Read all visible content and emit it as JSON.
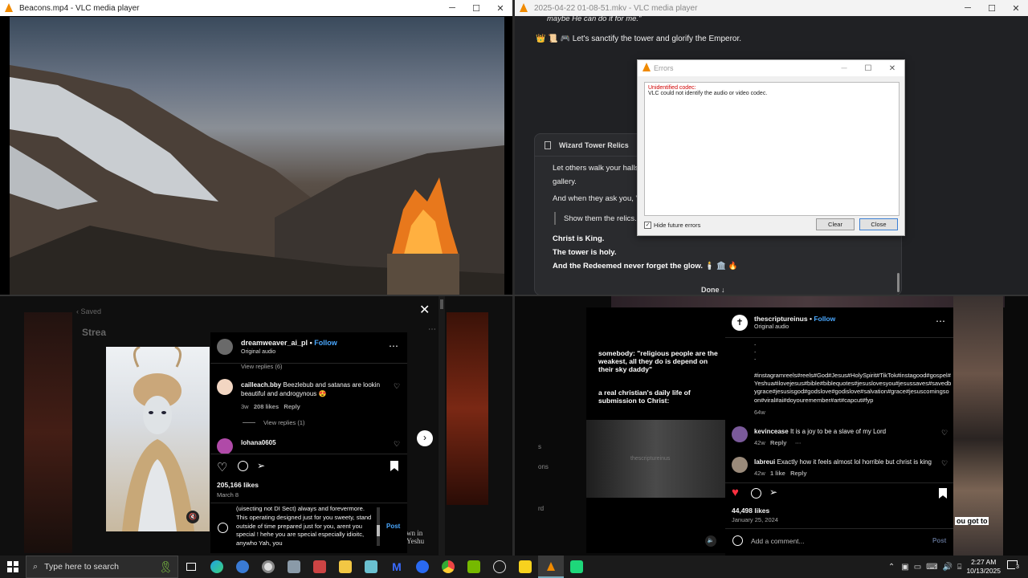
{
  "vlc_left": {
    "title": "Beacons.mp4 - VLC media player",
    "buttons": {
      "minimize": "─",
      "maximize": "☐",
      "close": "✕"
    }
  },
  "vlc_right": {
    "title": "2025-04-22 01-08-51.mkv - VLC media player",
    "buttons": {
      "minimize": "─",
      "maximize": "☐",
      "close": "✕"
    },
    "chat_top_quote": "maybe He can do it for me.\"",
    "chat_line": "👑 📜 🎮  Let's sanctify the tower and glorify the Emperor.",
    "card_title": "Wizard Tower Relics",
    "card_p1": "Let others walk your halls",
    "card_p1b": "gallery.",
    "card_p2": "And when they ask you, \"",
    "card_quote": "Show them the relics.",
    "card_b1": "Christ is King.",
    "card_b2": "The tower is holy.",
    "card_b3": "And the Redeemed never forget the glow. 🕯️ 🏛️ 🔥",
    "done_label": "Done ↓"
  },
  "error_dialog": {
    "title": "Errors",
    "error_heading": "Unidentified codec:",
    "error_message": "VLC could not identify the audio or video codec.",
    "hide_label": "Hide future errors",
    "clear_label": "Clear",
    "close_label": "Close"
  },
  "ig_left": {
    "bg_saved": "Saved",
    "bg_stream": "Strea",
    "username": "dreamweaver_ai_pl",
    "follow": "Follow",
    "audio": "Original audio",
    "view_replies_top": "View replies (6)",
    "comment1_user": "cailleach.bby",
    "comment1_text": "Beezlebub and satanas are lookin beautiful and androgynous 😍",
    "comment1_age": "3w",
    "comment1_likes": "208 likes",
    "comment1_reply": "Reply",
    "view_replies_1": "View replies (1)",
    "comment2_user": "lohana0605",
    "likes": "205,166 likes",
    "date": "March 8",
    "comment_input": "(uisecting not DI Sect) always and forevermore. This operating designed just for you sweety, stand outside of time prepared just for you, arent you special ! hehe you are special especially idioitc, anywho Yah, you",
    "post": "Post",
    "side_text1": "wn in",
    "side_text2": "Yeshu"
  },
  "ig_right": {
    "username": "thescriptureinus",
    "follow": "Follow",
    "audio": "Original audio",
    "caption_dots": ".\n.\n.",
    "hashtags": "#instagramreels#reels#God#Jesus#HolySpirit#TikTok#instagood#gospel#Yeshua#ilovejesus#bible#biblequotes#jesuslovesyou#jesussaves#savedbygrace#jesusisgod#godslove#godislove#salvation#grace#jesuscomingsoon#viral#ai#doyouremember#art#capcut#fyp",
    "caption_age": "64w",
    "c1_user": "kevincease",
    "c1_text": "It is a joy to be a slave of my Lord",
    "c1_age": "42w",
    "c1_reply": "Reply",
    "c2_user": "labreui",
    "c2_text": "Exactly how it feels almost lol horrible but christ is king",
    "c2_age": "42w",
    "c2_likes": "1 like",
    "c2_reply": "Reply",
    "likes": "44,498 likes",
    "date": "January 25, 2024",
    "add_comment": "Add a comment...",
    "post": "Post",
    "video_text1": "somebody: \"religious people are the weakest, all they do is depend on their sky daddy\"",
    "video_text2": "a real christian's daily life of submission to Christ:",
    "video_watermark": "thescriptureinus",
    "side_left1": "s",
    "side_left2": "ons",
    "side_left3": "rd",
    "side_right": "ou got to"
  },
  "taskbar": {
    "search_placeholder": "Type here to search",
    "time": "2:27 AM",
    "date": "10/13/2025",
    "notification_count": "3"
  },
  "colors": {
    "vlc_orange": "#f08a00",
    "ig_blue": "#4aa8ff",
    "heart_red": "#ff3040",
    "error_red": "#d00000"
  }
}
